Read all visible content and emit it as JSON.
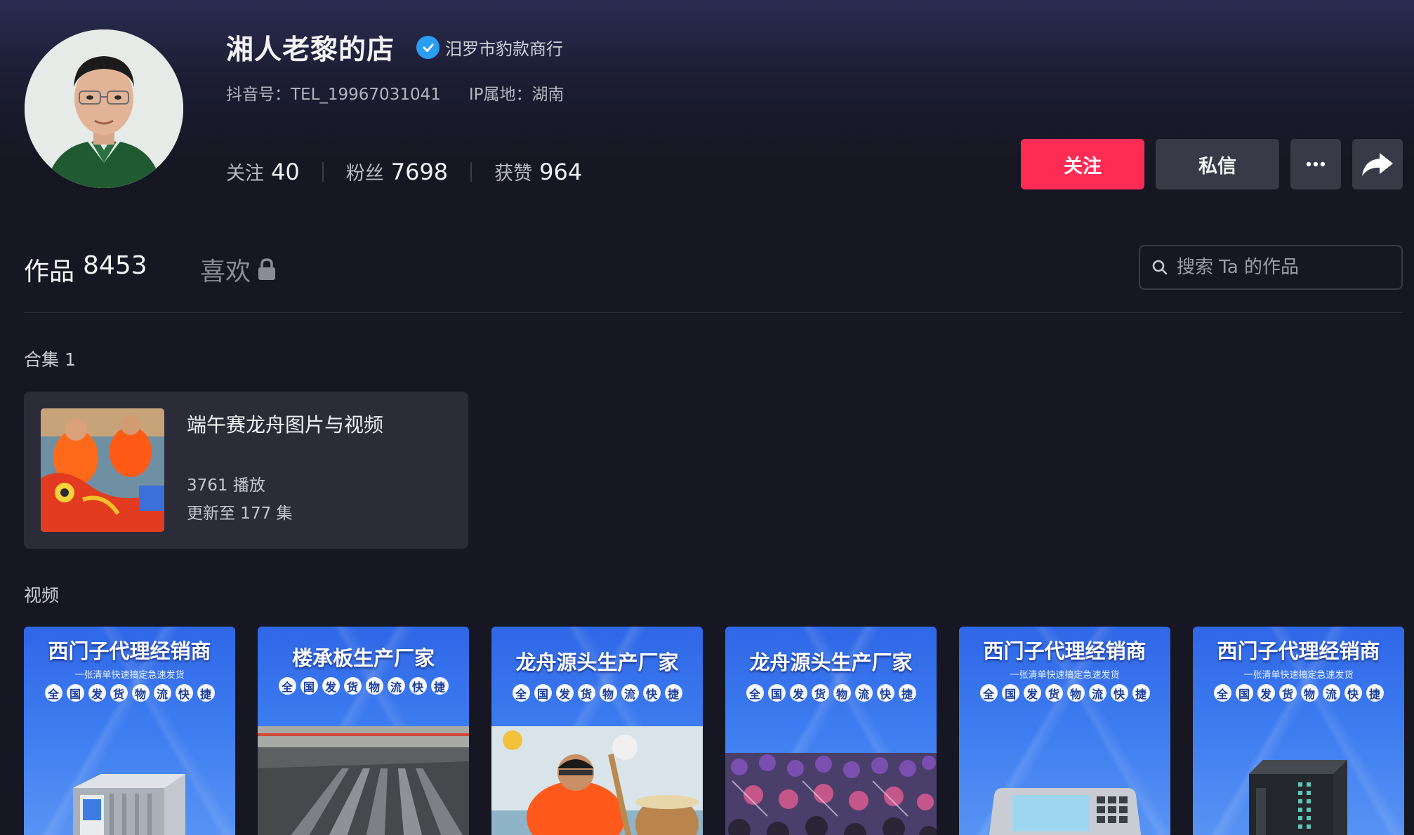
{
  "profile": {
    "name": "湘人老黎的店",
    "verified_label": "汨罗市豹款商行",
    "douyin_id": "抖音号：TEL_19967031041",
    "ip_location": "IP属地：湖南",
    "stats": [
      {
        "label": "关注",
        "value": "40"
      },
      {
        "label": "粉丝",
        "value": "7698"
      },
      {
        "label": "获赞",
        "value": "964"
      }
    ]
  },
  "actions": {
    "follow": "关注",
    "message": "私信",
    "more_icon": "more-icon",
    "share_icon": "share-icon"
  },
  "tabs": {
    "works_label": "作品",
    "works_count": "8453",
    "likes_label": "喜欢"
  },
  "search": {
    "placeholder": "搜索 Ta 的作品"
  },
  "collection_section": {
    "title": "合集 1",
    "card": {
      "title": "端午赛龙舟图片与视频",
      "plays": "3761 播放",
      "update": "更新至 177 集"
    }
  },
  "videos_section": {
    "title": "视频",
    "items": [
      {
        "title": "西门子代理经销商",
        "subtitle": "一张清单快速搞定急速发货",
        "chars": [
          "全",
          "国",
          "发",
          "货",
          "物",
          "流",
          "快",
          "捷"
        ]
      },
      {
        "title": "楼承板生产厂家",
        "subtitle": "",
        "chars": [
          "全",
          "国",
          "发",
          "货",
          "物",
          "流",
          "快",
          "捷"
        ]
      },
      {
        "title": "龙舟源头生产厂家",
        "subtitle": "",
        "chars": [
          "全",
          "国",
          "发",
          "货",
          "物",
          "流",
          "快",
          "捷"
        ]
      },
      {
        "title": "龙舟源头生产厂家",
        "subtitle": "",
        "chars": [
          "全",
          "国",
          "发",
          "货",
          "物",
          "流",
          "快",
          "捷"
        ]
      },
      {
        "title": "西门子代理经销商",
        "subtitle": "一张清单快速搞定急速发货",
        "chars": [
          "全",
          "国",
          "发",
          "货",
          "物",
          "流",
          "快",
          "捷"
        ]
      },
      {
        "title": "西门子代理经销商",
        "subtitle": "一张清单快速搞定急速发货",
        "chars": [
          "全",
          "国",
          "发",
          "货",
          "物",
          "流",
          "快",
          "捷"
        ]
      }
    ]
  },
  "colors": {
    "accent": "#fe2c55",
    "verify": "#2a9df4",
    "background": "#161722"
  }
}
